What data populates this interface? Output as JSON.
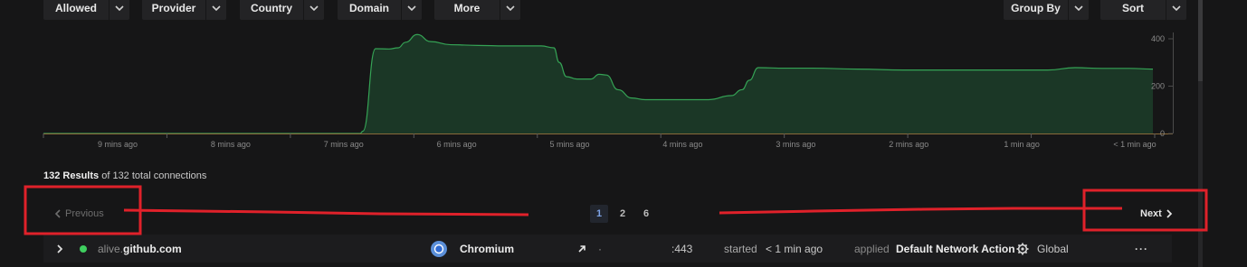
{
  "filters": {
    "allowed": "Allowed",
    "provider": "Provider",
    "country": "Country",
    "domain": "Domain",
    "more": "More",
    "group_by": "Group By",
    "sort": "Sort"
  },
  "chart_data": {
    "type": "area",
    "x_ticks": [
      "9 mins ago",
      "8 mins ago",
      "7 mins ago",
      "6 mins ago",
      "5 mins ago",
      "4 mins ago",
      "3 mins ago",
      "2 mins ago",
      "1 min ago",
      "< 1 min ago"
    ],
    "y_ticks": [
      400,
      200,
      0
    ],
    "ylim": [
      0,
      400
    ],
    "xlim": [
      0,
      1226
    ],
    "series": [
      {
        "x": [
          0,
          350,
          353,
          367,
          382,
          392,
          400,
          413,
          428,
          450,
          480,
          510,
          550,
          564,
          570,
          578,
          590,
          605,
          614,
          622,
          635,
          650,
          665,
          690,
          735,
          760,
          772,
          780,
          790,
          820,
          850,
          900,
          950,
          1000,
          1050,
          1080,
          1110,
          1140,
          1170,
          1200,
          1226
        ],
        "y": [
          0,
          0,
          10,
          358,
          357,
          362,
          385,
          418,
          388,
          375,
          372,
          370,
          370,
          362,
          300,
          240,
          230,
          230,
          250,
          247,
          185,
          150,
          143,
          143,
          143,
          160,
          185,
          225,
          278,
          276,
          276,
          272,
          268,
          268,
          268,
          268,
          268,
          278,
          275,
          275,
          272
        ]
      }
    ],
    "colors": {
      "fill": "#1b3726",
      "line": "#35a355",
      "axis": "#4a4a4a",
      "baseline": "#8a6a3a"
    }
  },
  "results": {
    "count": "132 Results",
    "suffix": "of 132 total connections"
  },
  "pagination": {
    "previous": "Previous",
    "next": "Next",
    "pages": [
      "1",
      "2",
      "6"
    ]
  },
  "connection": {
    "domain_prefix": "alive.",
    "domain_main": "github.com",
    "app": "Chromium",
    "dot": "·",
    "port": ":443",
    "started_label": "started",
    "started_value": "< 1 min ago",
    "applied_label": "applied",
    "action": "Default Network Action",
    "scope": "Global",
    "more": "···",
    "status_color": "#3fcf5f"
  }
}
